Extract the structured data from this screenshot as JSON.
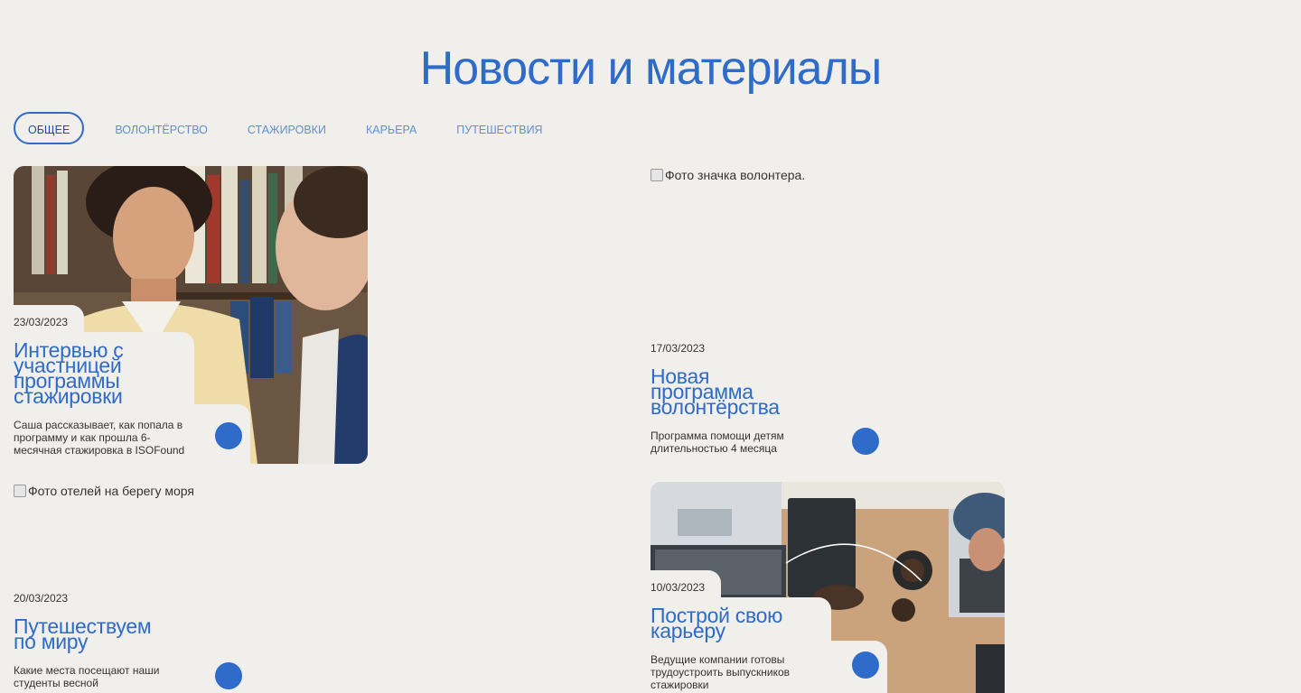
{
  "page": {
    "title": "Новости и материалы"
  },
  "tabs": [
    {
      "label": "ОБЩЕЕ",
      "active": true
    },
    {
      "label": "ВОЛОНТЁРСТВО"
    },
    {
      "label": "СТАЖИРОВКИ"
    },
    {
      "label": "КАРЬЕРА"
    },
    {
      "label": "ПУТЕШЕСТВИЯ"
    }
  ],
  "cards": [
    {
      "date": "23/03/2023",
      "title": "Интервью с участницей программы стажировки",
      "description": "Саша рассказывает, как попала в программу и как прошла 6-месячная стажировка в ISOFound"
    },
    {
      "image_alt": "Фото значка волонтера.",
      "date": "17/03/2023",
      "title": "Новая программа волонтёрства",
      "description": "Программа помощи детям длительностью 4 месяца"
    },
    {
      "image_alt": "Фото отелей на берегу моря",
      "date": "20/03/2023",
      "title": "Путешествуем по миру",
      "description": "Какие места посещают наши студенты весной"
    },
    {
      "date": "10/03/2023",
      "title": "Построй свою карьеру",
      "description": "Ведущие компании готовы трудоустроить выпускников стажировки"
    }
  ],
  "colors": {
    "accent": "#2f6bc8",
    "background": "#f0efeb"
  }
}
